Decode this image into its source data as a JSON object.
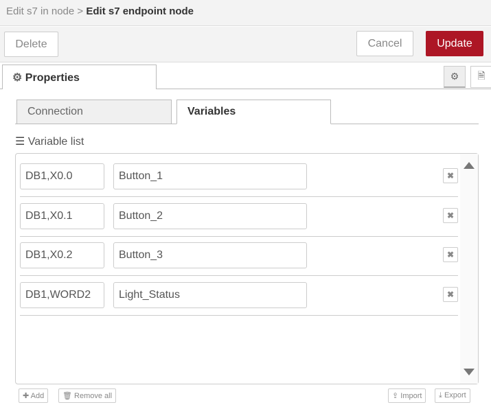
{
  "header": {
    "parent": "Edit s7 in node",
    "separator": ">",
    "title": "Edit s7 endpoint node"
  },
  "toolbar": {
    "delete": "Delete",
    "cancel": "Cancel",
    "update": "Update",
    "update_color": "#ad1625"
  },
  "tabs": {
    "properties": "Properties",
    "connection": "Connection",
    "variables": "Variables"
  },
  "variables": {
    "label": "Variable list",
    "rows": [
      {
        "address": "DB1,X0.0",
        "name": "Button_1"
      },
      {
        "address": "DB1,X0.1",
        "name": "Button_2"
      },
      {
        "address": "DB1,X0.2",
        "name": "Button_3"
      },
      {
        "address": "DB1,WORD2",
        "name": "Light_Status"
      }
    ]
  },
  "footer": {
    "add": "Add",
    "remove_all": "Remove all",
    "import": "Import",
    "export": "Export"
  }
}
